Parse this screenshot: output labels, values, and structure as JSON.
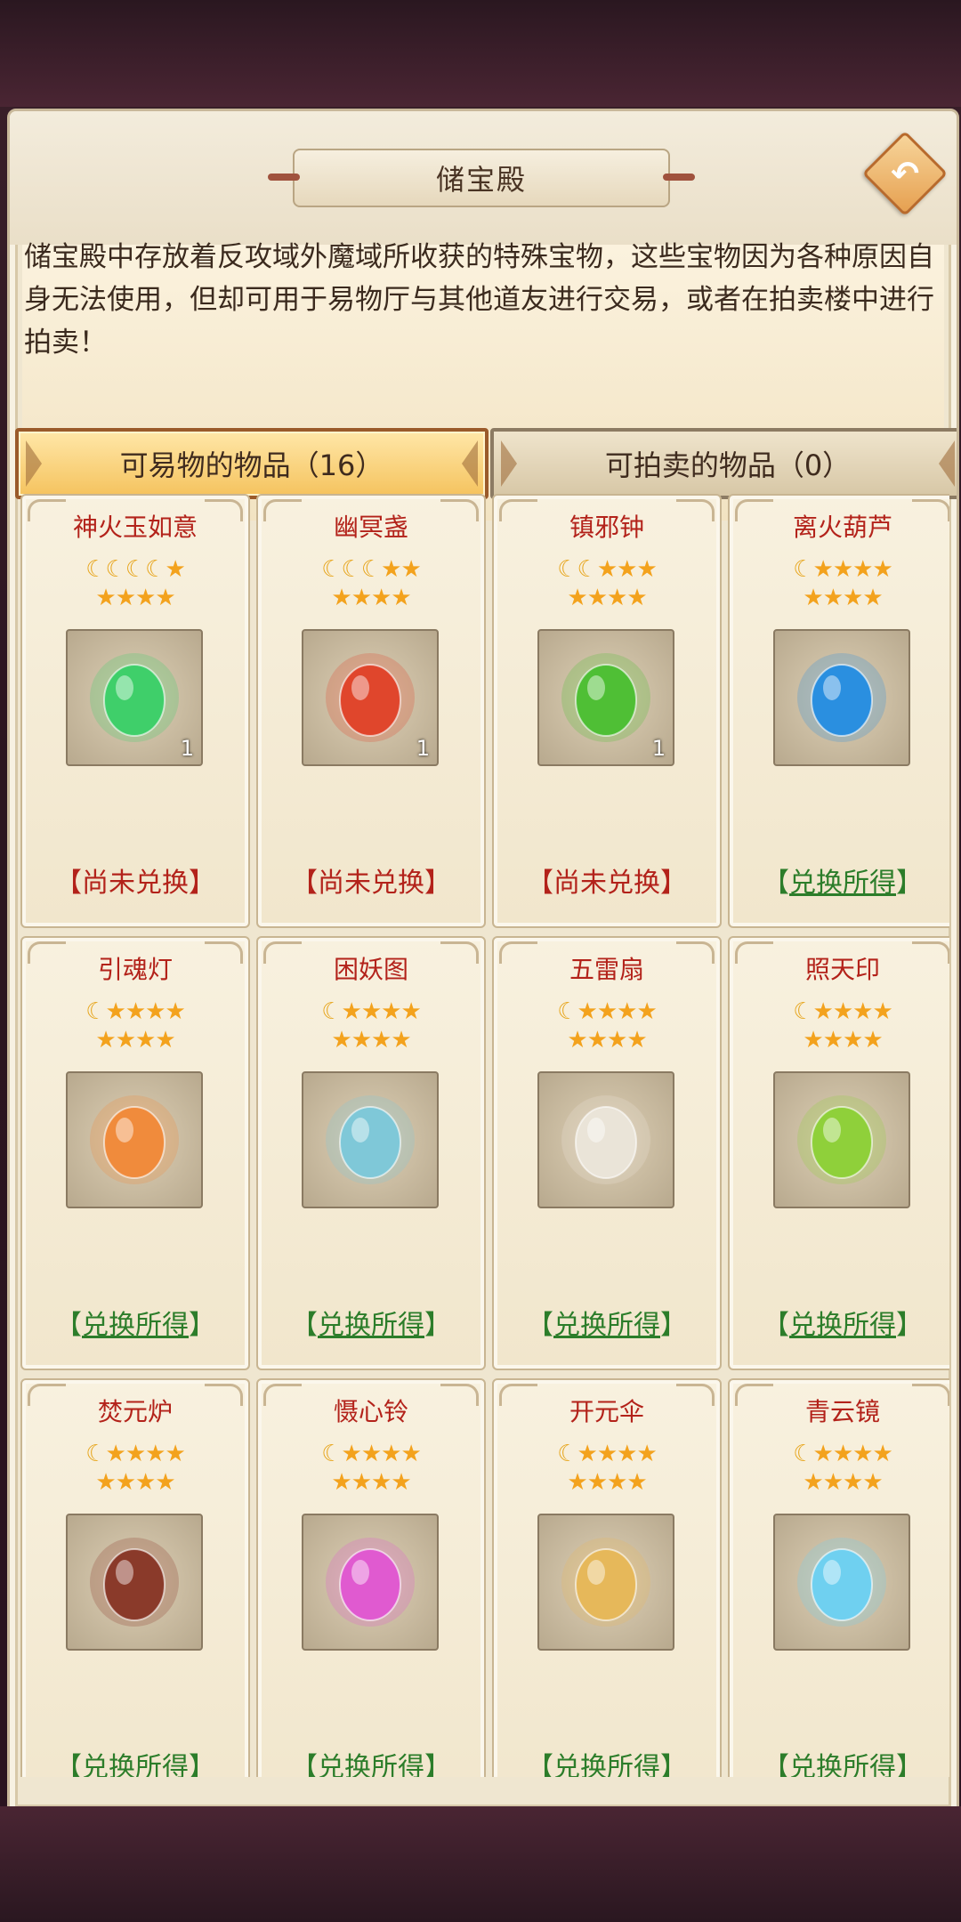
{
  "header": {
    "title": "储宝殿"
  },
  "description": "储宝殿中存放着反攻域外魔域所收获的特殊宝物，这些宝物因为各种原因自身无法使用，但却可用于易物厅与其他道友进行交易，或者在拍卖楼中进行拍卖！",
  "tabs": [
    {
      "label": "可易物的物品（16）",
      "active": true
    },
    {
      "label": "可拍卖的物品（0）",
      "active": false
    }
  ],
  "status_labels": {
    "pending": "【尚未兑换】",
    "done_left": "【",
    "done_link": "兑换所得",
    "done_right": "】"
  },
  "items": [
    {
      "name": "神火玉如意",
      "moons": 4,
      "stars_row1": 1,
      "stars_row2": 4,
      "qty": "1",
      "status": "pending",
      "icon": "jade-ruyi-icon",
      "color": "#3fcf6a"
    },
    {
      "name": "幽冥盏",
      "moons": 3,
      "stars_row1": 2,
      "stars_row2": 4,
      "qty": "1",
      "status": "pending",
      "icon": "red-lantern-icon",
      "color": "#e0462c"
    },
    {
      "name": "镇邪钟",
      "moons": 2,
      "stars_row1": 3,
      "stars_row2": 4,
      "qty": "1",
      "status": "pending",
      "icon": "green-bell-icon",
      "color": "#4fbf35"
    },
    {
      "name": "离火葫芦",
      "moons": 1,
      "stars_row1": 4,
      "stars_row2": 4,
      "qty": "",
      "status": "done",
      "icon": "blue-gourd-icon",
      "color": "#2a8fe0"
    },
    {
      "name": "引魂灯",
      "moons": 1,
      "stars_row1": 4,
      "stars_row2": 4,
      "qty": "",
      "status": "done",
      "icon": "soul-lamp-icon",
      "color": "#f08b3c"
    },
    {
      "name": "困妖图",
      "moons": 1,
      "stars_row1": 4,
      "stars_row2": 4,
      "qty": "",
      "status": "done",
      "icon": "scroll-icon",
      "color": "#7fc8d8"
    },
    {
      "name": "五雷扇",
      "moons": 1,
      "stars_row1": 4,
      "stars_row2": 4,
      "qty": "",
      "status": "done",
      "icon": "fan-icon",
      "color": "#eae4d8"
    },
    {
      "name": "照天印",
      "moons": 1,
      "stars_row1": 4,
      "stars_row2": 4,
      "qty": "",
      "status": "done",
      "icon": "jade-seal-icon",
      "color": "#8fd03a"
    },
    {
      "name": "焚元炉",
      "moons": 1,
      "stars_row1": 4,
      "stars_row2": 4,
      "qty": "",
      "status": "done",
      "icon": "cauldron-icon",
      "color": "#8a3a2a"
    },
    {
      "name": "慑心铃",
      "moons": 1,
      "stars_row1": 4,
      "stars_row2": 4,
      "qty": "",
      "status": "done",
      "icon": "pink-bell-icon",
      "color": "#e05ad0"
    },
    {
      "name": "开元伞",
      "moons": 1,
      "stars_row1": 4,
      "stars_row2": 4,
      "qty": "",
      "status": "done",
      "icon": "umbrella-icon",
      "color": "#e6b85a"
    },
    {
      "name": "青云镜",
      "moons": 1,
      "stars_row1": 4,
      "stars_row2": 4,
      "qty": "",
      "status": "done",
      "icon": "mirror-icon",
      "color": "#6fd0f0"
    }
  ]
}
